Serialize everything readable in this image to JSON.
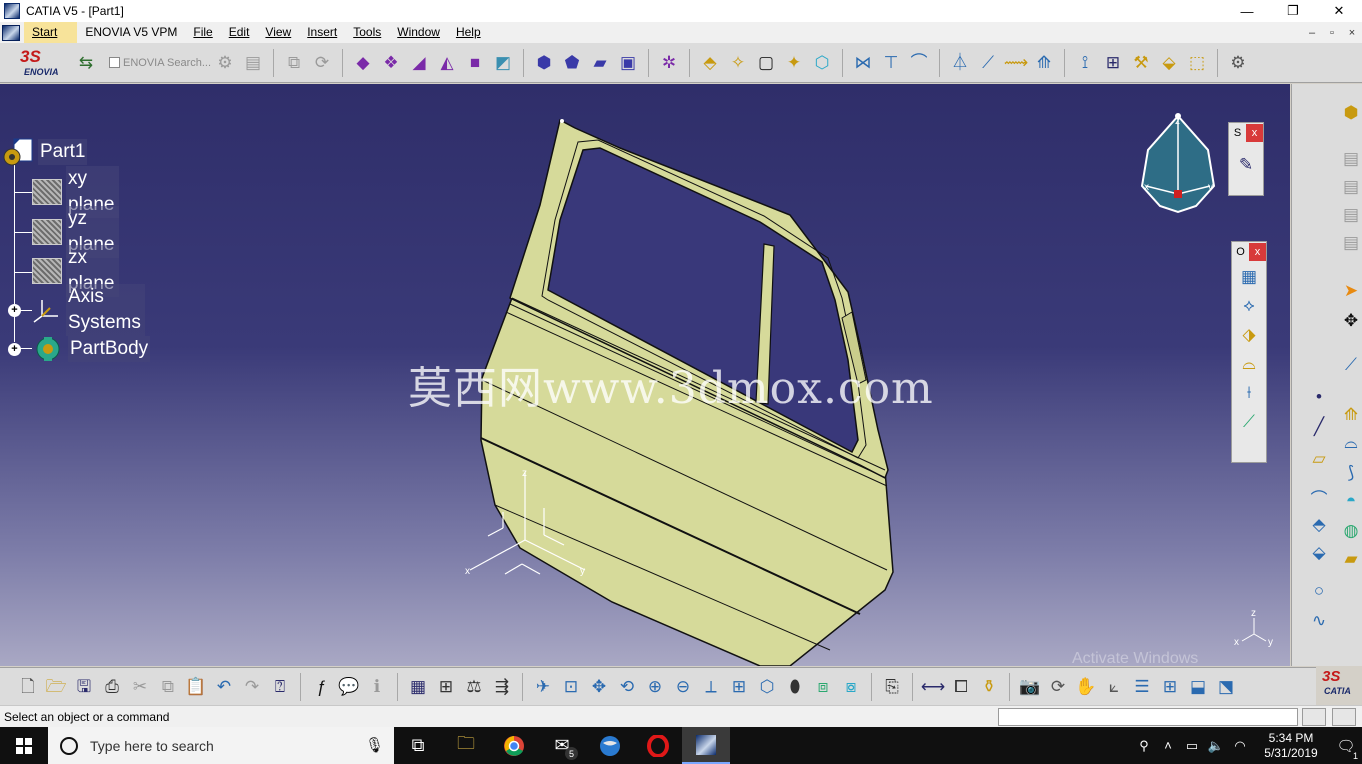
{
  "window": {
    "title": "CATIA V5 - [Part1]",
    "minimize": "—",
    "maximize": "❐",
    "close": "✕"
  },
  "menu": {
    "start": "Start",
    "enovia": "ENOVIA V5 VPM",
    "file": "File",
    "edit": "Edit",
    "view": "View",
    "insert": "Insert",
    "tools": "Tools",
    "window": "Window",
    "help": "Help"
  },
  "toolbar": {
    "enovia_search": "ENOVIA Search..."
  },
  "logos": {
    "ds": "3S",
    "enovia": "ENOVIA",
    "catia": "CATIA"
  },
  "tree": {
    "root": "Part1",
    "items": [
      {
        "label": "xy plane"
      },
      {
        "label": "yz plane"
      },
      {
        "label": "zx plane"
      },
      {
        "label": "Axis Systems"
      },
      {
        "label": "PartBody"
      }
    ]
  },
  "axis_labels": {
    "x": "x",
    "y": "y",
    "z": "z"
  },
  "watermark": "莫西网www.3dmox.com",
  "activate_windows": "Activate Windows",
  "panels": {
    "sketch_title": "S",
    "ops_title": "O",
    "close": "x"
  },
  "status": {
    "message": "Select an object or a command"
  },
  "taskbar": {
    "search_placeholder": "Type here to search",
    "mail_badge": "5",
    "time": "5:34 PM",
    "date": "5/31/2019",
    "notifications": "1"
  },
  "colors": {
    "part_fill": "#d6da9a",
    "viewport_top": "#2f2e6a",
    "viewport_bottom": "#a9a8c4",
    "compass": "#2e6d86"
  }
}
